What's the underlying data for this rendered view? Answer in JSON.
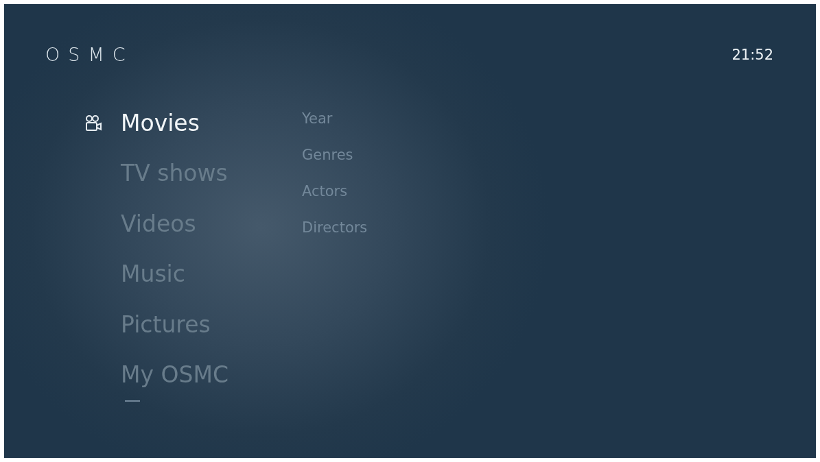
{
  "logo": "OSMC",
  "clock": "21:52",
  "menu": [
    {
      "label": "Movies",
      "selected": true
    },
    {
      "label": "TV shows",
      "selected": false
    },
    {
      "label": "Videos",
      "selected": false
    },
    {
      "label": "Music",
      "selected": false
    },
    {
      "label": "Pictures",
      "selected": false
    },
    {
      "label": "My OSMC",
      "selected": false
    }
  ],
  "submenu": [
    "Year",
    "Genres",
    "Actors",
    "Directors"
  ]
}
